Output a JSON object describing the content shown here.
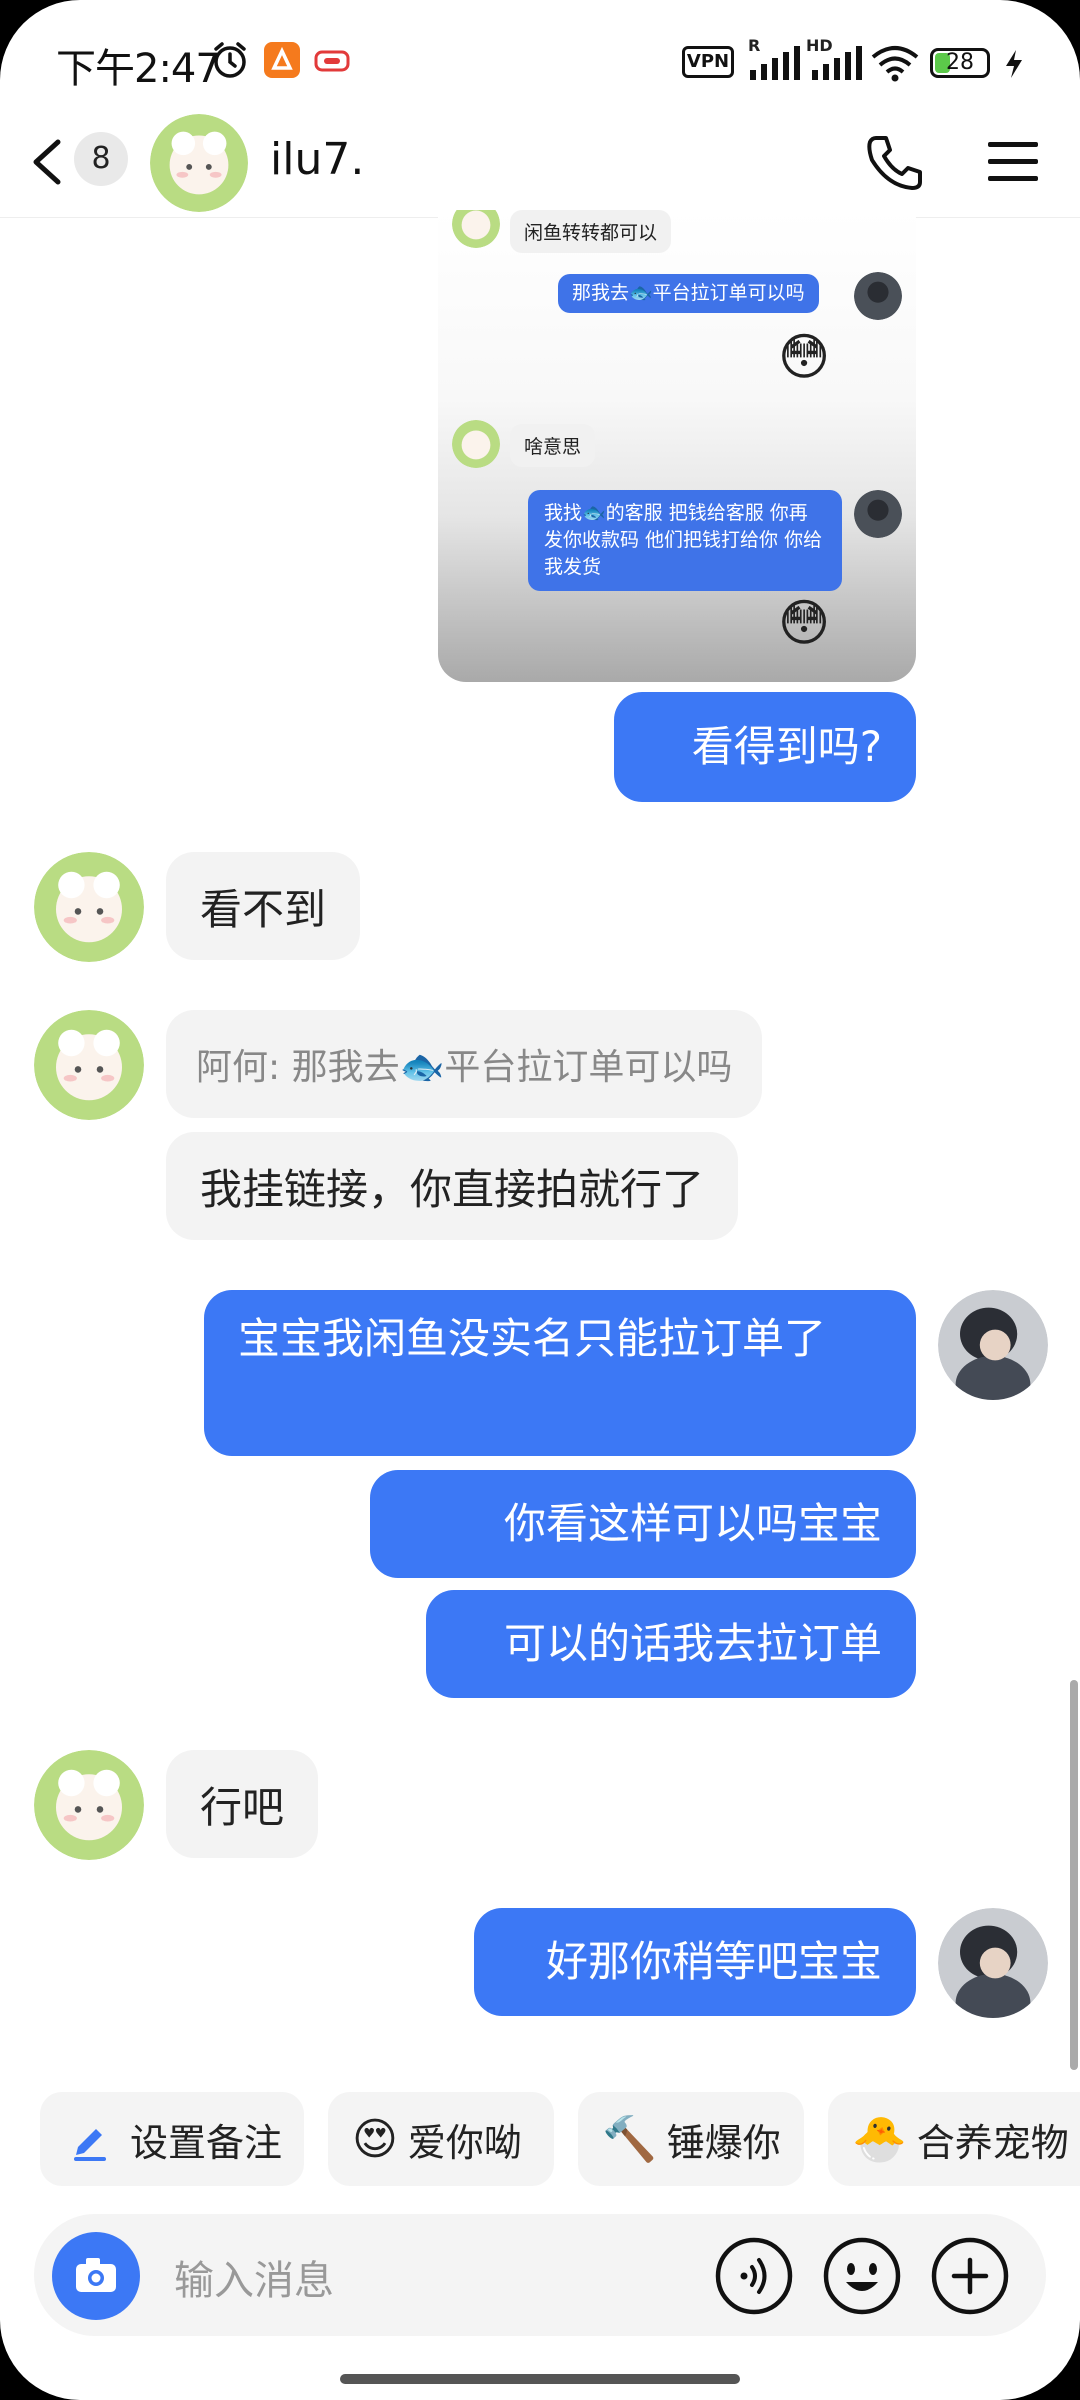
{
  "status_bar": {
    "time": "下午2:47",
    "vpn": "VPN",
    "battery": "28",
    "signal1_tag": "R",
    "signal2_tag": "HD"
  },
  "header": {
    "unread_count": "8",
    "peer_name": "ilu7."
  },
  "embedded_screenshot": {
    "messages": [
      {
        "side": "in",
        "text": "闲鱼转转都可以"
      },
      {
        "side": "out",
        "text": "那我去🐟平台拉订单可以吗"
      },
      {
        "side": "out",
        "text": "😳"
      },
      {
        "side": "in",
        "text": "啥意思"
      },
      {
        "side": "out",
        "text": "我找🐟的客服 把钱给客服 你再发你收款码 他们把钱打给你 你给我发货"
      },
      {
        "side": "out",
        "text": "😳"
      }
    ]
  },
  "messages": [
    {
      "side": "out",
      "text": "看得到吗?"
    },
    {
      "side": "in",
      "text": "看不到"
    },
    {
      "side": "in",
      "quote": true,
      "text": "阿何: 那我去🐟平台拉订单可以吗"
    },
    {
      "side": "in",
      "text": "我挂链接，你直接拍就行了"
    },
    {
      "side": "out",
      "text": "宝宝我闲鱼没实名只能拉订单了"
    },
    {
      "side": "out",
      "text": "你看这样可以吗宝宝"
    },
    {
      "side": "out",
      "text": "可以的话我去拉订单"
    },
    {
      "side": "in",
      "text": "行吧"
    },
    {
      "side": "out",
      "text": "好那你稍等吧宝宝"
    }
  ],
  "quick_actions": [
    {
      "label": "设置备注",
      "icon": "pencil-icon"
    },
    {
      "label": "爱你呦",
      "icon": "😍"
    },
    {
      "label": "锤爆你",
      "icon": "🔨"
    },
    {
      "label": "合养宠物",
      "icon": "🐣"
    }
  ],
  "input": {
    "placeholder": "输入消息"
  },
  "colors": {
    "outgoing_bubble": "#3c78f5",
    "incoming_bubble": "#f3f3f3",
    "accent": "#3c78f5"
  }
}
